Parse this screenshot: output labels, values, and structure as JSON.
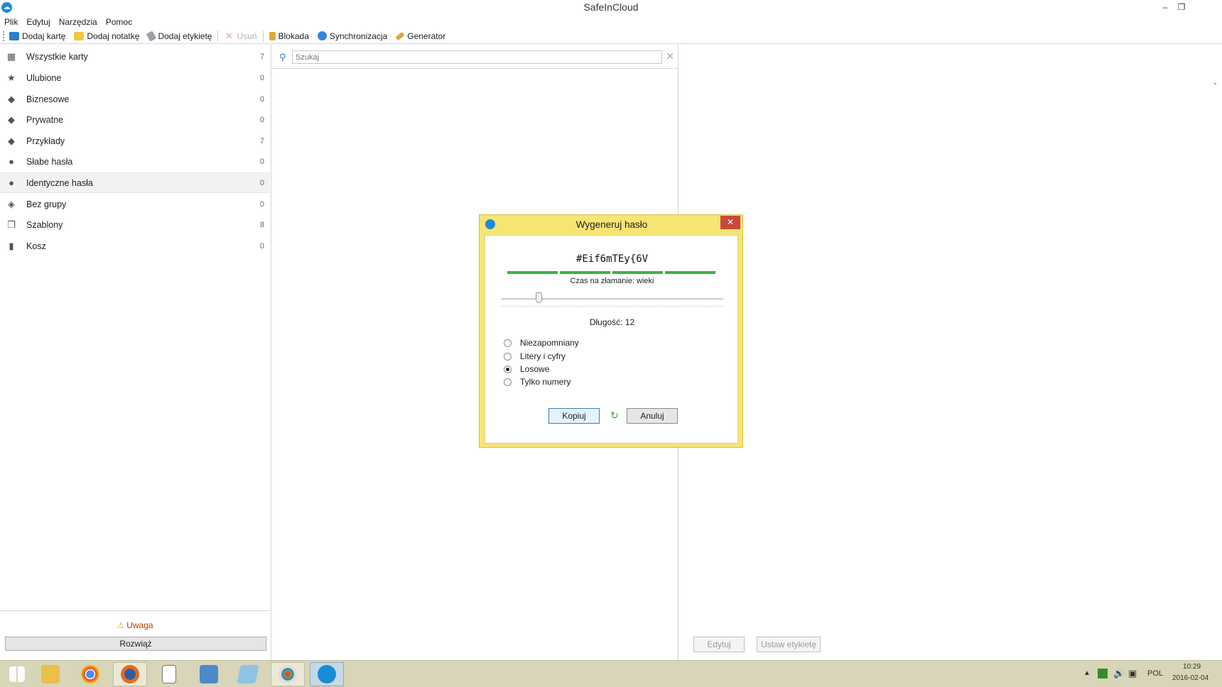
{
  "window": {
    "title": "SafeInCloud",
    "minimize": "–",
    "restore": "❐",
    "close": "✕"
  },
  "menu": [
    "Plik",
    "Edytuj",
    "Narzędzia",
    "Pomoc"
  ],
  "toolbar": {
    "add_card": "Dodaj kartę",
    "add_note": "Dodaj notatkę",
    "add_label": "Dodaj etykietę",
    "delete": "Usuń",
    "lock": "Blokada",
    "sync": "Synchronizacja",
    "generator": "Generator"
  },
  "sidebar": {
    "items": [
      {
        "label": "Wszystkie karty",
        "count": "7",
        "icon": "grid-icon"
      },
      {
        "label": "Ulubione",
        "count": "0",
        "icon": "star-icon"
      },
      {
        "label": "Biznesowe",
        "count": "0",
        "icon": "tag-icon"
      },
      {
        "label": "Prywatne",
        "count": "0",
        "icon": "tag-icon"
      },
      {
        "label": "Przykłady",
        "count": "7",
        "icon": "tag-icon"
      },
      {
        "label": "Słabe hasła",
        "count": "0",
        "icon": "alert-icon"
      },
      {
        "label": "Identyczne hasła",
        "count": "0",
        "icon": "alert-icon"
      },
      {
        "label": "Bez grupy",
        "count": "0",
        "icon": "untagged-icon"
      },
      {
        "label": "Szablony",
        "count": "8",
        "icon": "templates-icon"
      },
      {
        "label": "Kosz",
        "count": "0",
        "icon": "trash-icon"
      }
    ],
    "warning": "Uwaga",
    "resolve": "Rozwiąż"
  },
  "search": {
    "placeholder": "Szukaj",
    "value": ""
  },
  "detail": {
    "edit": "Edytuj",
    "set_label": "Ustaw etykietę"
  },
  "dialog": {
    "title": "Wygeneruj hasło",
    "password": "#Eif6mTEy{6V",
    "crack_time": "Czas na złamanie: wieki",
    "length_label": "Długość: 12",
    "length": 12,
    "options": [
      {
        "label": "Niezapomniany",
        "selected": false
      },
      {
        "label": "Litery i cyfry",
        "selected": false
      },
      {
        "label": "Losowe",
        "selected": true
      },
      {
        "label": "Tylko numery",
        "selected": false
      }
    ],
    "copy": "Kopiuj",
    "cancel": "Anuluj",
    "close": "✕"
  },
  "taskbar": {
    "lang": "POL",
    "time": "10:29",
    "date": "2016-02-04",
    "apps": [
      "start-icon",
      "file-explorer-icon",
      "chrome-icon",
      "firefox-icon",
      "notepad-icon",
      "wtw-icon",
      "document-icon",
      "paint-icon",
      "safeincloud-icon"
    ]
  }
}
